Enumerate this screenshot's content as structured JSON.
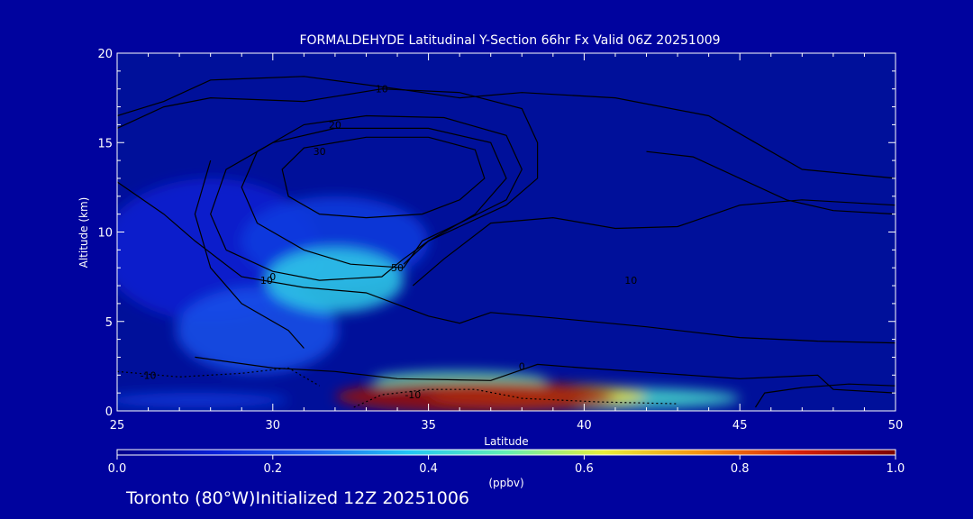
{
  "chart_data": {
    "type": "heatmap",
    "title": "FORMALDEHYDE Latitudinal Y-Section 66hr  Fx Valid 06Z 20251009",
    "xlabel": "Latitude",
    "ylabel": "Altitude (km)",
    "xlim": [
      25,
      50
    ],
    "ylim": [
      0,
      20
    ],
    "x_ticks": [
      "25",
      "30",
      "35",
      "40",
      "45",
      "50"
    ],
    "y_ticks": [
      "0",
      "5",
      "10",
      "15",
      "20"
    ],
    "colorbar": {
      "label": "(ppbv)",
      "range": [
        0.0,
        1.0
      ],
      "ticks": [
        "0.0",
        "0.2",
        "0.4",
        "0.6",
        "0.8",
        "1.0"
      ],
      "colors": [
        "#00008a",
        "#0a1fd6",
        "#1e62f0",
        "#22c6f5",
        "#63f0b4",
        "#e8f03a",
        "#f5900f",
        "#d81f0a",
        "#7a0000"
      ]
    },
    "blobs": [
      {
        "lat": 36.5,
        "alt": 0.8,
        "rlat": 4.5,
        "ralt": 0.9,
        "value": 0.95
      },
      {
        "lat": 38.5,
        "alt": 0.8,
        "rlat": 3.5,
        "ralt": 0.7,
        "value": 0.65
      },
      {
        "lat": 41.0,
        "alt": 0.7,
        "rlat": 4.0,
        "ralt": 0.6,
        "value": 0.45
      },
      {
        "lat": 36.0,
        "alt": 1.7,
        "rlat": 2.8,
        "ralt": 0.5,
        "value": 0.5
      },
      {
        "lat": 32.0,
        "alt": 7.3,
        "rlat": 2.2,
        "ralt": 1.8,
        "value": 0.4
      },
      {
        "lat": 29.5,
        "alt": 4.5,
        "rlat": 2.6,
        "ralt": 2.4,
        "value": 0.22
      },
      {
        "lat": 32.0,
        "alt": 9.5,
        "rlat": 3.0,
        "ralt": 2.5,
        "value": 0.18
      },
      {
        "lat": 27.5,
        "alt": 0.6,
        "rlat": 3.0,
        "ralt": 0.4,
        "value": 0.18
      },
      {
        "lat": 28.0,
        "alt": 9.0,
        "rlat": 3.5,
        "ralt": 4.0,
        "value": 0.12
      }
    ],
    "contours": [
      {
        "label": "-10",
        "label_at": [
          26.0,
          2.0
        ],
        "dashed": true,
        "points": [
          [
            25.0,
            2.2
          ],
          [
            27.0,
            1.9
          ],
          [
            29.0,
            2.1
          ],
          [
            30.5,
            2.4
          ],
          [
            31.5,
            1.4
          ]
        ]
      },
      {
        "label": "-10",
        "label_at": [
          34.5,
          0.9
        ],
        "dashed": true,
        "points": [
          [
            32.6,
            0.2
          ],
          [
            33.5,
            0.9
          ],
          [
            35.0,
            1.2
          ],
          [
            36.5,
            1.2
          ],
          [
            38.0,
            0.7
          ],
          [
            40.5,
            0.5
          ],
          [
            43.0,
            0.4
          ]
        ]
      },
      {
        "label": "0",
        "label_at": [
          38.0,
          2.5
        ],
        "dashed": false,
        "points": [
          [
            27.5,
            3.0
          ],
          [
            30.0,
            2.4
          ],
          [
            32.0,
            2.2
          ],
          [
            34.0,
            1.8
          ],
          [
            37.0,
            1.7
          ],
          [
            38.5,
            2.6
          ],
          [
            40.0,
            2.4
          ],
          [
            42.5,
            2.1
          ],
          [
            45.0,
            1.8
          ],
          [
            47.5,
            2.0
          ],
          [
            48.0,
            1.2
          ],
          [
            50.0,
            1.0
          ]
        ]
      },
      {
        "label": "0",
        "label_at": [
          30.0,
          7.5
        ],
        "dashed": false,
        "points": [
          [
            28.0,
            14.0
          ],
          [
            27.5,
            11.0
          ],
          [
            28.0,
            8.0
          ],
          [
            29.0,
            6.0
          ],
          [
            30.5,
            4.5
          ],
          [
            31.0,
            3.5
          ]
        ]
      },
      {
        "label": "10",
        "label_at": [
          29.8,
          7.3
        ],
        "dashed": false,
        "points": [
          [
            25.0,
            12.8
          ],
          [
            26.5,
            11.0
          ],
          [
            27.5,
            9.5
          ],
          [
            29.0,
            7.5
          ],
          [
            31.0,
            6.9
          ],
          [
            33.0,
            6.6
          ],
          [
            35.0,
            5.3
          ],
          [
            36.0,
            4.9
          ],
          [
            37.0,
            5.5
          ],
          [
            39.0,
            5.2
          ],
          [
            42.0,
            4.7
          ],
          [
            45.0,
            4.1
          ],
          [
            47.5,
            3.9
          ],
          [
            50.0,
            3.8
          ]
        ]
      },
      {
        "label": "10",
        "label_at": [
          41.5,
          7.3
        ],
        "dashed": false,
        "points": [
          [
            25.0,
            16.5
          ],
          [
            26.5,
            17.3
          ],
          [
            28.0,
            18.5
          ],
          [
            31.0,
            18.7
          ],
          [
            34.0,
            18.0
          ],
          [
            36.0,
            17.5
          ],
          [
            38.0,
            17.8
          ],
          [
            41.0,
            17.5
          ],
          [
            44.0,
            16.5
          ],
          [
            45.5,
            15.0
          ],
          [
            47.0,
            13.5
          ],
          [
            50.0,
            13.0
          ]
        ]
      },
      {
        "label": "10",
        "label_at": [
          33.5,
          18.0
        ],
        "dashed": false,
        "points": [
          [
            25.0,
            15.8
          ],
          [
            26.5,
            17.0
          ],
          [
            28.0,
            17.5
          ],
          [
            31.0,
            17.3
          ],
          [
            33.5,
            18.0
          ],
          [
            36.0,
            17.8
          ],
          [
            38.0,
            16.9
          ],
          [
            38.5,
            15.0
          ],
          [
            38.5,
            13.0
          ],
          [
            37.5,
            11.5
          ],
          [
            36.0,
            10.3
          ],
          [
            35.0,
            9.5
          ],
          [
            34.2,
            8.2
          ]
        ]
      },
      {
        "label": "20",
        "label_at": [
          32.0,
          16.0
        ],
        "dashed": false,
        "points": [
          [
            34.2,
            8.0
          ],
          [
            32.5,
            8.2
          ],
          [
            31.0,
            9.0
          ],
          [
            29.5,
            10.5
          ],
          [
            29.0,
            12.5
          ],
          [
            29.5,
            14.5
          ],
          [
            31.0,
            16.0
          ],
          [
            33.0,
            16.5
          ],
          [
            35.5,
            16.4
          ],
          [
            37.5,
            15.4
          ],
          [
            38.0,
            13.5
          ],
          [
            37.5,
            11.8
          ],
          [
            36.0,
            10.5
          ],
          [
            34.8,
            9.5
          ],
          [
            34.2,
            8.0
          ]
        ]
      },
      {
        "label": "30",
        "label_at": [
          31.5,
          14.5
        ],
        "dashed": false,
        "points": [
          [
            33.0,
            10.8
          ],
          [
            31.5,
            11.0
          ],
          [
            30.5,
            12.0
          ],
          [
            30.3,
            13.5
          ],
          [
            31.0,
            14.7
          ],
          [
            33.0,
            15.3
          ],
          [
            35.0,
            15.3
          ],
          [
            36.5,
            14.6
          ],
          [
            36.8,
            13.0
          ],
          [
            36.0,
            11.8
          ],
          [
            34.8,
            11.0
          ],
          [
            33.0,
            10.8
          ]
        ]
      },
      {
        "label": "50",
        "label_at": [
          34.0,
          8.0
        ],
        "dashed": false,
        "points": [
          [
            28.5,
            9.0
          ],
          [
            28.0,
            11.0
          ],
          [
            28.5,
            13.5
          ],
          [
            30.0,
            15.0
          ],
          [
            32.0,
            15.8
          ],
          [
            35.0,
            15.8
          ],
          [
            37.0,
            15.0
          ],
          [
            37.5,
            13.0
          ],
          [
            36.5,
            11.0
          ],
          [
            35.0,
            9.5
          ],
          [
            34.2,
            8.5
          ],
          [
            33.5,
            7.5
          ],
          [
            31.5,
            7.3
          ],
          [
            30.0,
            7.8
          ],
          [
            28.5,
            9.0
          ]
        ]
      },
      {
        "label": "",
        "label_at": null,
        "dashed": false,
        "points": [
          [
            34.5,
            7.0
          ],
          [
            35.5,
            8.5
          ],
          [
            37.0,
            10.5
          ],
          [
            39.0,
            10.8
          ],
          [
            41.0,
            10.2
          ],
          [
            43.0,
            10.3
          ],
          [
            45.0,
            11.5
          ],
          [
            47.0,
            11.8
          ],
          [
            50.0,
            11.5
          ]
        ]
      },
      {
        "label": "",
        "label_at": null,
        "dashed": false,
        "points": [
          [
            42.0,
            14.5
          ],
          [
            43.5,
            14.2
          ],
          [
            45.0,
            13.0
          ],
          [
            46.5,
            11.8
          ],
          [
            48.0,
            11.2
          ],
          [
            50.0,
            11.0
          ]
        ]
      },
      {
        "label": "",
        "label_at": null,
        "dashed": false,
        "points": [
          [
            45.5,
            0.2
          ],
          [
            45.8,
            1.0
          ],
          [
            47.0,
            1.3
          ],
          [
            48.5,
            1.5
          ],
          [
            50.0,
            1.4
          ]
        ]
      }
    ]
  },
  "footer": {
    "text": "Toronto (80°W)Initialized 12Z 20251006"
  }
}
